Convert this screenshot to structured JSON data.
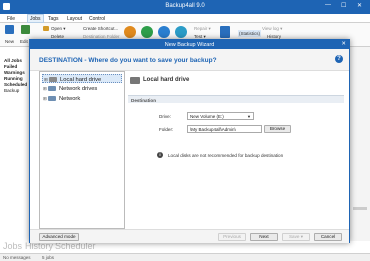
{
  "app": {
    "title": "Backup4all 9.0",
    "window_controls": [
      "—",
      "☐",
      "✕"
    ]
  },
  "menu": [
    "File",
    "Jobs",
    "Tags",
    "Layout",
    "Control"
  ],
  "ribbon": {
    "new": "New",
    "edit": "Edit",
    "open": "Open ▾",
    "delete": "Delete",
    "create_shortcut": "Create Shortcut...",
    "destination_folder": "Destination Folder",
    "repair": "Repair ▾",
    "test": "Test ▾",
    "statistics": "(Statistics)",
    "view_log": "View log ▾",
    "history": "History"
  },
  "left_pane": [
    "All Jobs",
    "Failed",
    "Warnings",
    "Running",
    "Scheduled",
    "Backup"
  ],
  "bottom_tabs": [
    "Jobs",
    "History",
    "Scheduler"
  ],
  "status": {
    "messages": "No messages",
    "jobs": "5 jobs"
  },
  "dialog": {
    "title": "New Backup Wizard",
    "close": "✕",
    "question": "DESTINATION - Where do you want to save your backup?",
    "help": "?",
    "tree": [
      {
        "label": "Local hard drive",
        "selected": true
      },
      {
        "label": "Network drives",
        "selected": false
      },
      {
        "label": "Network",
        "selected": false
      }
    ],
    "content_title": "Local hard drive",
    "section": "Destination",
    "drive_label": "Drive:",
    "drive_value": "New Volume (E:)",
    "folder_label": "Folder:",
    "folder_value": "\\My Backup4all\\Admin\\",
    "browse": "Browse",
    "info": "Local disks are not recommended for backup destination",
    "buttons": {
      "advanced": "Advanced mode",
      "previous": "Previous",
      "next": "Next",
      "save": "Save ▾",
      "cancel": "Cancel"
    }
  },
  "colors": {
    "accent": "#1e64b4",
    "highlight": "#dbe9f8"
  }
}
